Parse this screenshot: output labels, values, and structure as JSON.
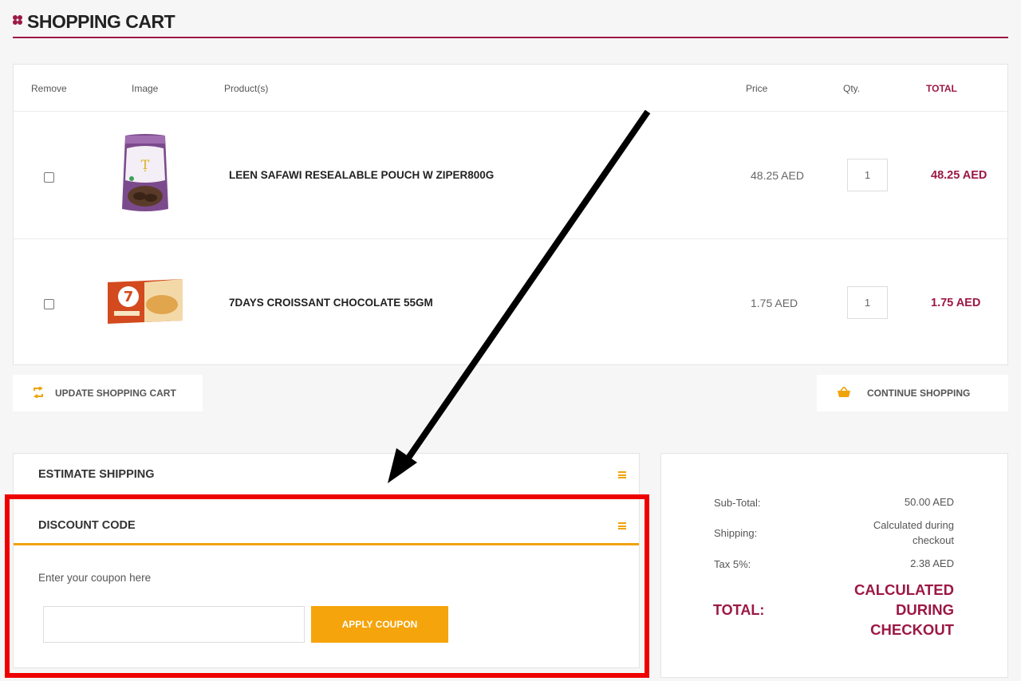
{
  "page": {
    "title": "SHOPPING CART"
  },
  "table": {
    "headers": {
      "remove": "Remove",
      "image": "Image",
      "products": "Product(s)",
      "price": "Price",
      "qty": "Qty.",
      "total": "TOTAL"
    },
    "rows": [
      {
        "name": "LEEN SAFAWI RESEALABLE POUCH W ZIPER800G",
        "price": "48.25 AED",
        "qty": "1",
        "total": "48.25 AED"
      },
      {
        "name": "7DAYS CROISSANT CHOCOLATE 55GM",
        "price": "1.75 AED",
        "qty": "1",
        "total": "1.75 AED"
      }
    ]
  },
  "actions": {
    "update": "UPDATE SHOPPING CART",
    "continue": "CONTINUE SHOPPING"
  },
  "shipping": {
    "title": "ESTIMATE SHIPPING"
  },
  "discount": {
    "title": "DISCOUNT CODE",
    "label": "Enter your coupon here",
    "input_value": "",
    "apply": "APPLY COUPON"
  },
  "summary": {
    "subtotal_label": "Sub-Total:",
    "subtotal": "50.00 AED",
    "shipping_label": "Shipping:",
    "shipping": "Calculated during checkout",
    "tax_label": "Tax 5%:",
    "tax": "2.38 AED",
    "total_label": "TOTAL:",
    "total": "CALCULATED DURING CHECKOUT"
  },
  "colors": {
    "brand": "#9c1845",
    "accent": "#f5a40b",
    "highlight": "#ee0000"
  },
  "icons": {
    "update": "refresh-icon",
    "continue": "basket-icon",
    "accordion": "hamburger-icon"
  }
}
